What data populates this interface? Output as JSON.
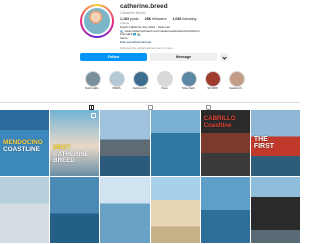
{
  "profile": {
    "username": "catherine.breed",
    "full_name": "Catherine Breed",
    "stats": [
      {
        "num": "1,183",
        "label": "posts"
      },
      {
        "num": "28K",
        "label": "followers"
      },
      {
        "num": "1,036",
        "label": "following"
      }
    ],
    "bio": [
      {
        "text": "Athlete",
        "style": "muted"
      },
      {
        "text": "South California July 2024 · Swimmer",
        "style": "normal"
      },
      {
        "text": "🌊 www.catherinebreed.com/mastersocals/swim/NorthPoint",
        "style": "normal"
      },
      {
        "text": "Founded 🌎 🏊",
        "style": "normal"
      },
      {
        "text": "Swim",
        "style": "normal"
      },
      {
        "text": "linktr.ee/catherinebreed",
        "style": "link"
      }
    ],
    "followed_by": "Followed by catherinebreed and 1 more",
    "buttons": {
      "follow": "Follow",
      "message": "Message"
    }
  },
  "highlights": [
    {
      "label": "South Califo...",
      "color": "#7a8f9c"
    },
    {
      "label": "PRESS",
      "color": "#b4c8d6"
    },
    {
      "label": "Swimmers B...",
      "color": "#3e6e8f"
    },
    {
      "label": "Press",
      "color": "#d9d9d9"
    },
    {
      "label": "Tahoe Swim",
      "color": "#5c88a6"
    },
    {
      "label": "SF 4900ft",
      "color": "#9e3b2e"
    },
    {
      "label": "Catalina Ch...",
      "color": "#c29c86"
    }
  ],
  "tabs": {
    "posts": "posts-tab",
    "reels": "reels-tab",
    "tagged": "tagged-tab"
  },
  "posts": [
    {
      "line1": "MENDOCINO",
      "line2": "COASTLINE"
    },
    {
      "line1": "MEET",
      "line2": "CATHERINE BREED"
    },
    {
      "line1": "",
      "line2": ""
    },
    {
      "line1": "",
      "line2": ""
    },
    {
      "line1": "CABRILLO",
      "line2": "Coastline"
    },
    {
      "line1": "THE",
      "line2": "FIRST"
    },
    {
      "line1": "",
      "line2": ""
    },
    {
      "line1": "",
      "line2": ""
    },
    {
      "line1": "",
      "line2": ""
    },
    {
      "line1": "",
      "line2": ""
    },
    {
      "line1": "",
      "line2": ""
    },
    {
      "line1": "",
      "line2": ""
    }
  ]
}
